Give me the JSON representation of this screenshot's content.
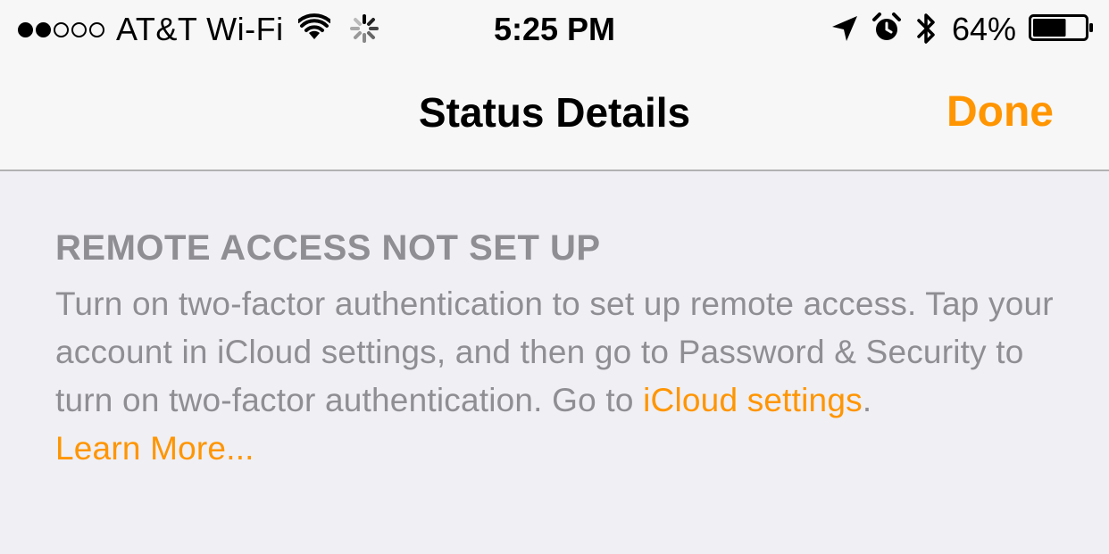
{
  "status_bar": {
    "signal_dots_filled": 2,
    "signal_dots_total": 5,
    "carrier": "AT&T Wi-Fi",
    "time": "5:25 PM",
    "battery_percent_text": "64%",
    "battery_level": 0.64,
    "icons": [
      "wifi-icon",
      "activity-spinner-icon",
      "location-arrow-icon",
      "alarm-clock-icon",
      "bluetooth-icon",
      "battery-icon"
    ]
  },
  "nav_bar": {
    "title": "Status Details",
    "done_label": "Done"
  },
  "section": {
    "header": "REMOTE ACCESS NOT SET UP",
    "body_text": "Turn on two-factor authentication to set up remote access. Tap your account in iCloud settings, and then go to Password & Security to turn on two-factor authentication. Go to ",
    "icloud_link": "iCloud settings",
    "period": ".",
    "learn_more": "Learn More..."
  },
  "colors": {
    "accent": "#ff9500",
    "secondary_text": "#8e8e93",
    "background": "#efeff4",
    "nav_background": "#f7f7f7"
  }
}
